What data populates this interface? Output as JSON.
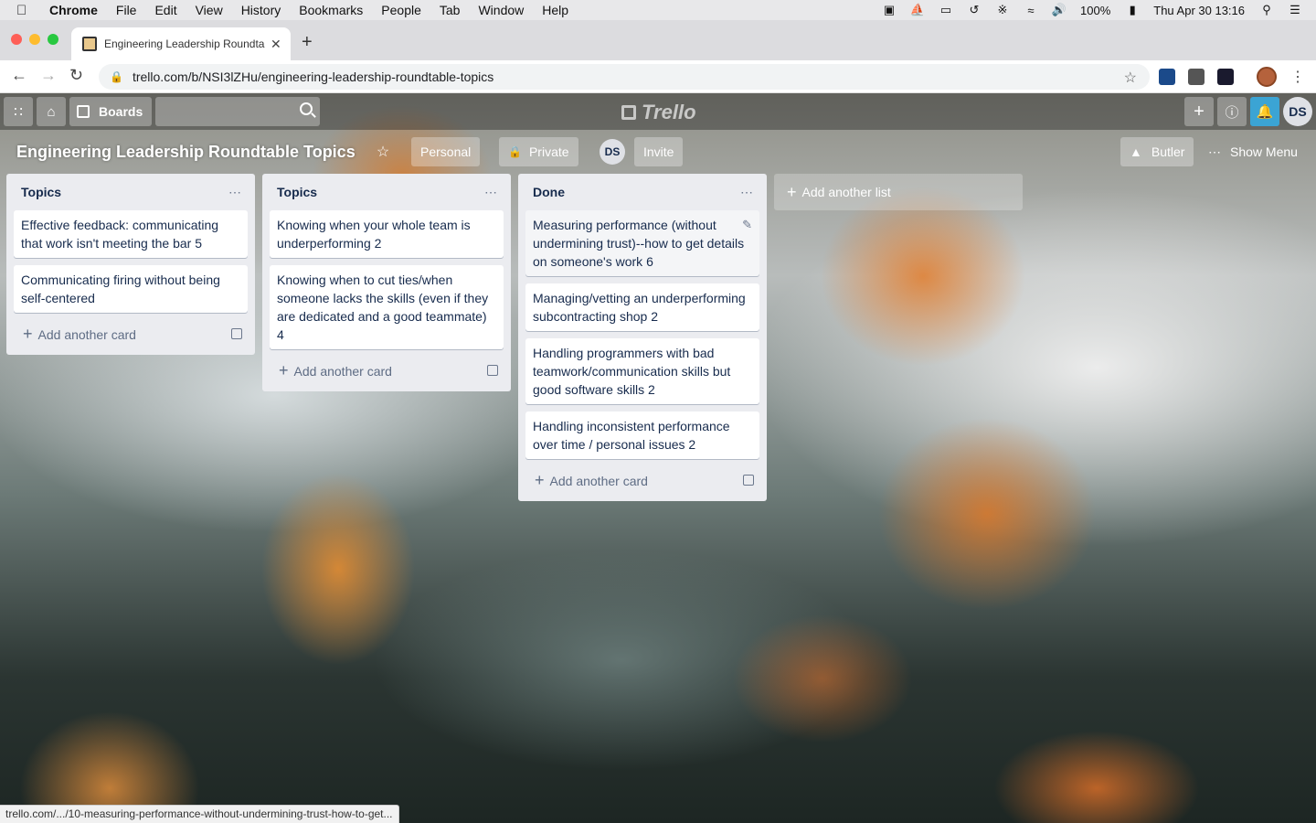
{
  "menubar": {
    "apple": "",
    "app": "Chrome",
    "items": [
      "File",
      "Edit",
      "View",
      "History",
      "Bookmarks",
      "People",
      "Tab",
      "Window",
      "Help"
    ],
    "battery": "100%",
    "datetime": "Thu Apr 30  13:16"
  },
  "browser": {
    "tab_title": "Engineering Leadership Roundtable Topics",
    "url": "trello.com/b/NSI3lZHu/engineering-leadership-roundtable-topics",
    "status_url": "trello.com/.../10-measuring-performance-without-undermining-trust-how-to-get..."
  },
  "header": {
    "boards_label": "Boards",
    "logo": "Trello",
    "member_initials": "DS"
  },
  "board": {
    "title": "Engineering Leadership Roundtable Topics",
    "team": "Personal",
    "visibility": "Private",
    "member_initials": "DS",
    "invite_label": "Invite",
    "butler_label": "Butler",
    "menu_label": "Show Menu",
    "add_list_label": "Add another list",
    "add_card_label": "Add another card"
  },
  "lists": [
    {
      "title": "Topics",
      "cards": [
        "Effective feedback: communicating that work isn't meeting the bar 5",
        "Communicating firing without being self-centered"
      ]
    },
    {
      "title": "Topics",
      "cards": [
        "Knowing when your whole team is underperforming 2",
        "Knowing when to cut ties/when someone lacks the skills (even if they are dedicated and a good teammate) 4"
      ]
    },
    {
      "title": "Done",
      "cards": [
        "Measuring performance (without undermining trust)--how to get details on someone's work 6",
        "Managing/vetting an underperforming subcontracting shop 2",
        "Handling programmers with bad teamwork/communication skills but good software skills 2",
        "Handling inconsistent performance over time / personal issues 2"
      ]
    }
  ]
}
